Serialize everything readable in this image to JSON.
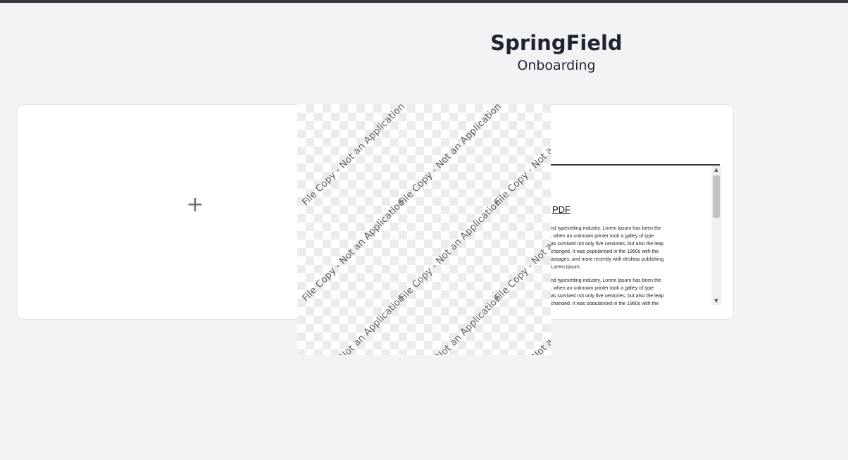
{
  "header": {
    "title": "SpringField",
    "subtitle": "Onboarding"
  },
  "upload": {
    "plus_symbol": "+"
  },
  "pdf_preview": {
    "title": "PDF",
    "paragraphs": [
      "nd typesetting industry. Lorem Ipsum has been the\n, when an unknown printer took a galley of type\nas survived not only five centuries, but also the leap\nchanged. It was popularised in the 1960s with the\nassages, and more recently with desktop publishing\n Lorem Ipsum.",
      "nd typesetting industry. Lorem Ipsum has been the\n, when an unknown printer took a galley of type\nas survived not only five centuries, but also the leap\nchanged. It was popularised in the 1960s with the"
    ],
    "scroll_up_symbol": "▲",
    "scroll_down_symbol": "▼"
  },
  "watermark": {
    "text": "File Copy - Not an Application"
  }
}
